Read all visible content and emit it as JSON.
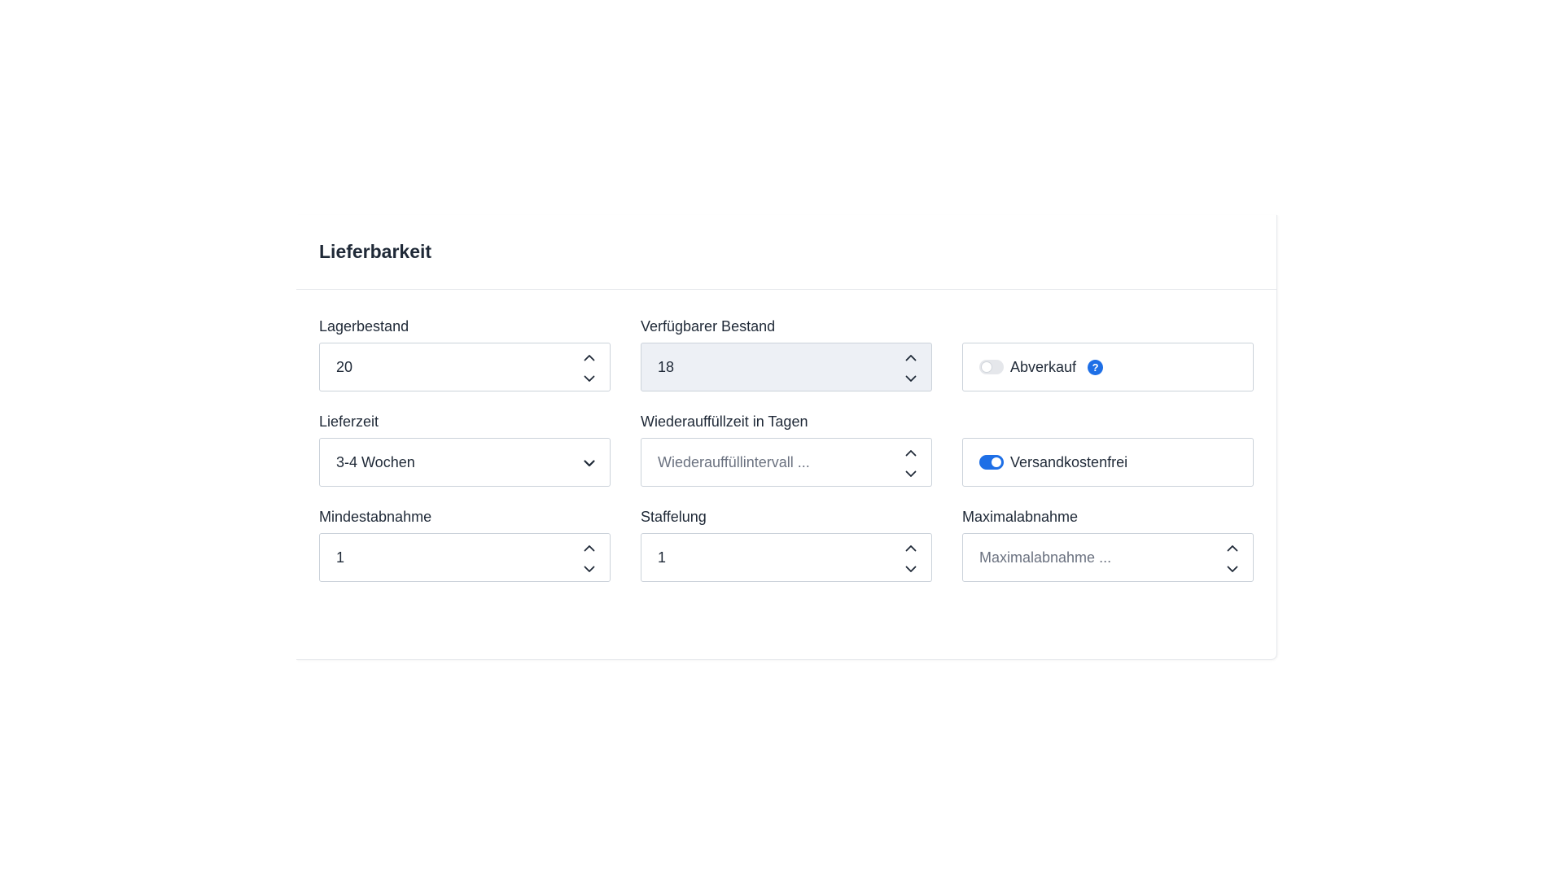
{
  "card": {
    "title": "Lieferbarkeit"
  },
  "fields": {
    "stock": {
      "label": "Lagerbestand",
      "value": "20"
    },
    "available_stock": {
      "label": "Verfügbarer Bestand",
      "value": "18"
    },
    "clearance_sale": {
      "label": "Abverkauf",
      "checked": false,
      "help_icon": "?"
    },
    "delivery_time": {
      "label": "Lieferzeit",
      "value": "3-4 Wochen"
    },
    "restock_time": {
      "label": "Wiederauffüllzeit in Tagen",
      "placeholder": "Wiederauffüllintervall ..."
    },
    "free_shipping": {
      "label": "Versandkostenfrei",
      "checked": true
    },
    "min_purchase": {
      "label": "Mindestabnahme",
      "value": "1"
    },
    "purchase_steps": {
      "label": "Staffelung",
      "value": "1"
    },
    "max_purchase": {
      "label": "Maximalabnahme",
      "placeholder": "Maximalabnahme ..."
    }
  },
  "icons": {
    "stepper_up": "chevron-up-icon",
    "stepper_down": "chevron-down-icon",
    "select_arrow": "chevron-down-icon",
    "help": "question-circle-icon"
  },
  "colors": {
    "accent": "#1e6fe6",
    "border": "#cbd2da",
    "disabled_bg": "#edf0f5",
    "divider": "#e5e7eb"
  }
}
